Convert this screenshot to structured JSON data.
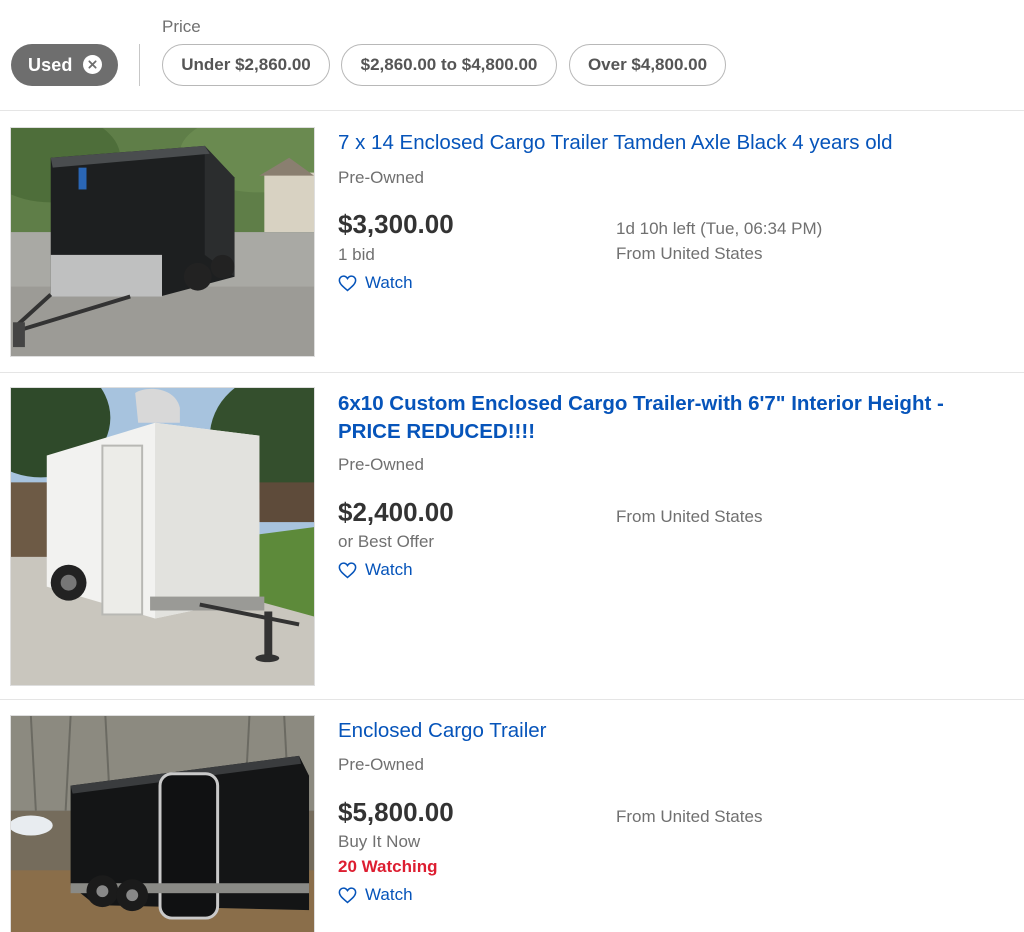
{
  "filters": {
    "active_chip": {
      "label": "Used",
      "icon": "close-circle-icon"
    },
    "price_heading": "Price",
    "price_options": [
      "Under $2,860.00",
      "$2,860.00 to $4,800.00",
      "Over $4,800.00"
    ]
  },
  "colors": {
    "link": "#0654ba",
    "price": "#333333",
    "secondary_text": "#707070",
    "watching_alert": "#dd1e31",
    "active_chip_bg": "#6e6e6e"
  },
  "listings": [
    {
      "title": "7 x 14 Enclosed Cargo Trailer Tamden Axle Black 4 years old",
      "condition": "Pre-Owned",
      "price": "$3,300.00",
      "purchase_info": "1 bid",
      "watch_label": "Watch",
      "time_left": "1d 10h left (Tue, 06:34 PM)",
      "location": "From United States",
      "image_alt": "black enclosed cargo trailer"
    },
    {
      "title": "6x10 Custom Enclosed Cargo Trailer-with 6'7\" Interior Height - PRICE REDUCED!!!!",
      "condition": "Pre-Owned",
      "price": "$2,400.00",
      "purchase_info": "or Best Offer",
      "watch_label": "Watch",
      "location": "From United States",
      "image_alt": "white enclosed cargo trailer"
    },
    {
      "title": "Enclosed Cargo Trailer",
      "condition": "Pre-Owned",
      "price": "$5,800.00",
      "purchase_info": "Buy It Now",
      "watching": "20 Watching",
      "watch_label": "Watch",
      "location": "From United States",
      "image_alt": "black tandem axle enclosed cargo trailer"
    }
  ]
}
